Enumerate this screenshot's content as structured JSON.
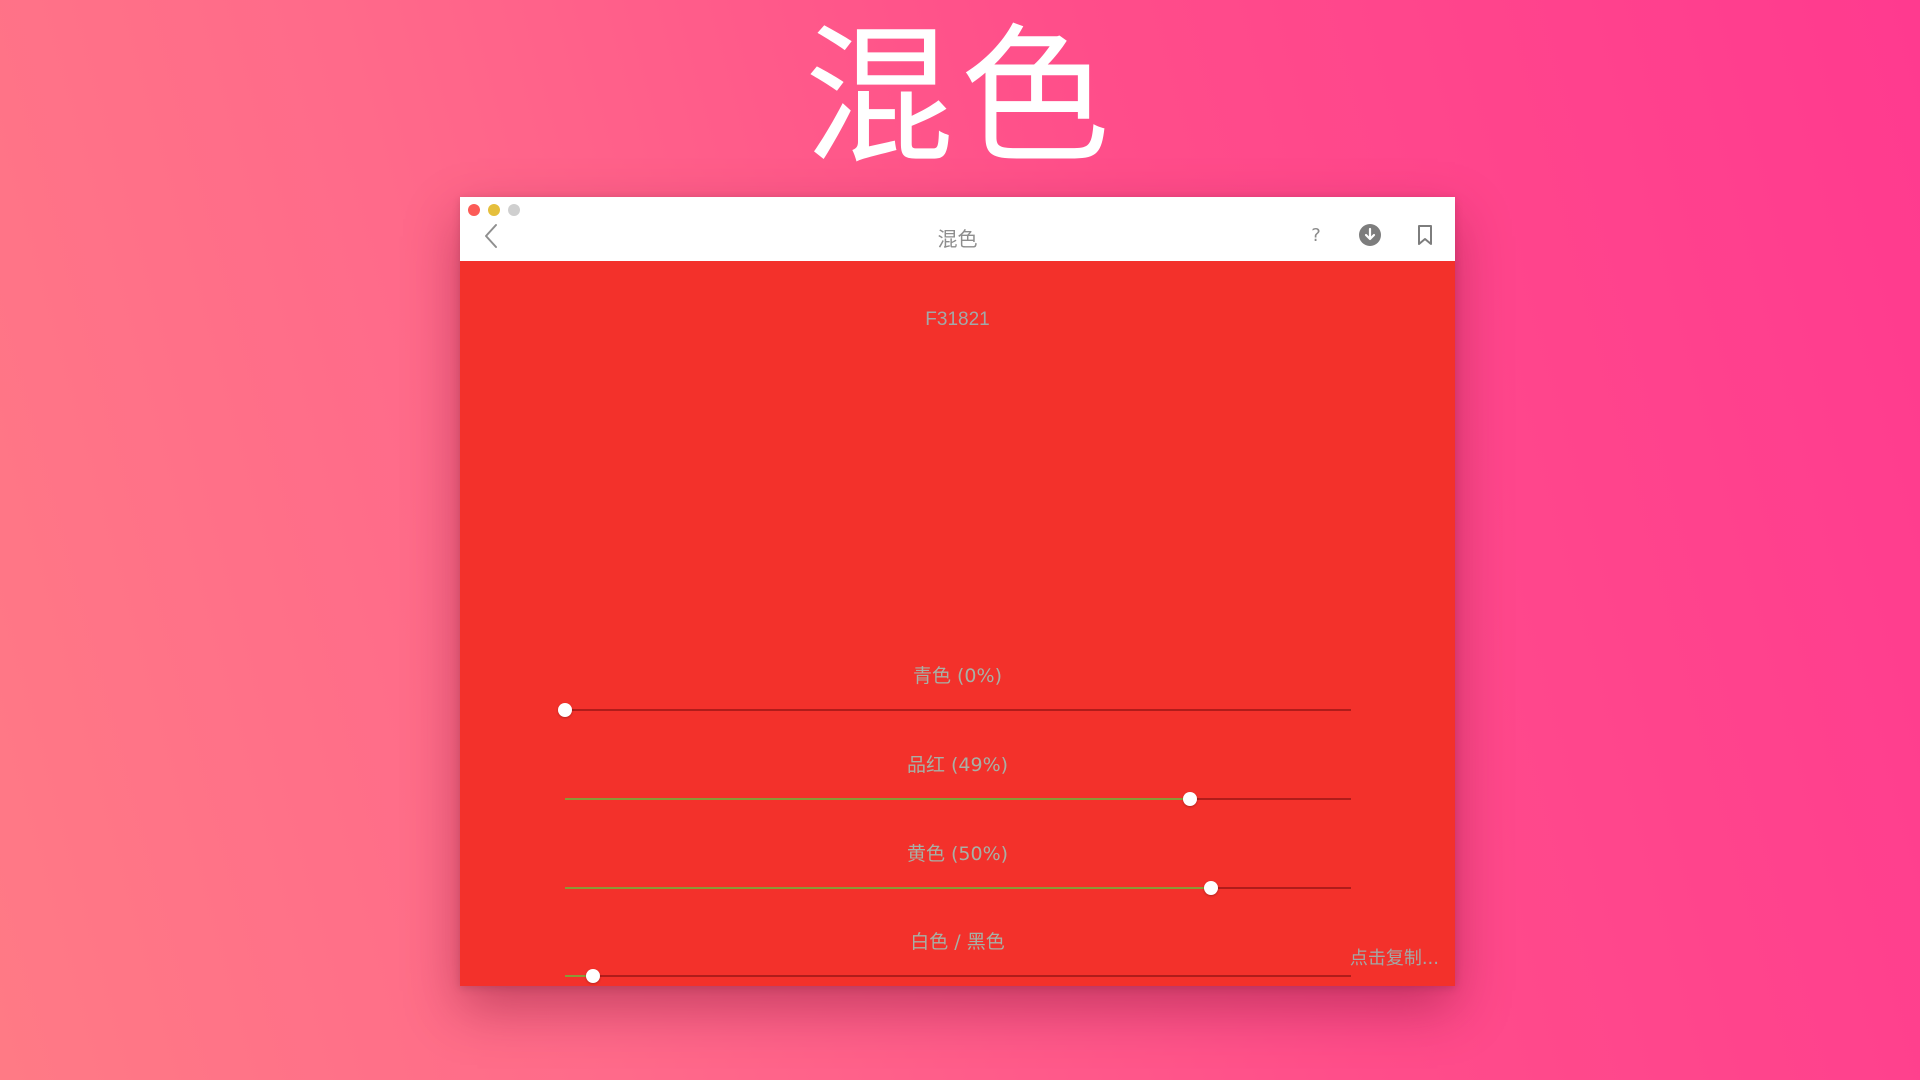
{
  "hero": {
    "title": "混色"
  },
  "window": {
    "title": "混色",
    "help_label": "?",
    "icons": {
      "back": "chevron-left-icon",
      "download": "download-circle-icon",
      "bookmark": "bookmark-icon"
    },
    "colors": {
      "background": "#F3312B",
      "titlebar": "#FFFFFF",
      "close": "#FC5B57",
      "minimize": "#E5BF3C",
      "zoom": "#CFCFCF"
    }
  },
  "mixer": {
    "hex": "F31821",
    "copy_hint": "点击复制...",
    "sliders": [
      {
        "id": "cyan",
        "label": "青色 (0%)",
        "value": 0.0
      },
      {
        "id": "magenta",
        "label": "品红 (49%)",
        "value": 0.795
      },
      {
        "id": "yellow",
        "label": "黄色 (50%)",
        "value": 0.822
      },
      {
        "id": "white-black",
        "label": "白色 / 黑色",
        "value": 0.035
      }
    ]
  }
}
